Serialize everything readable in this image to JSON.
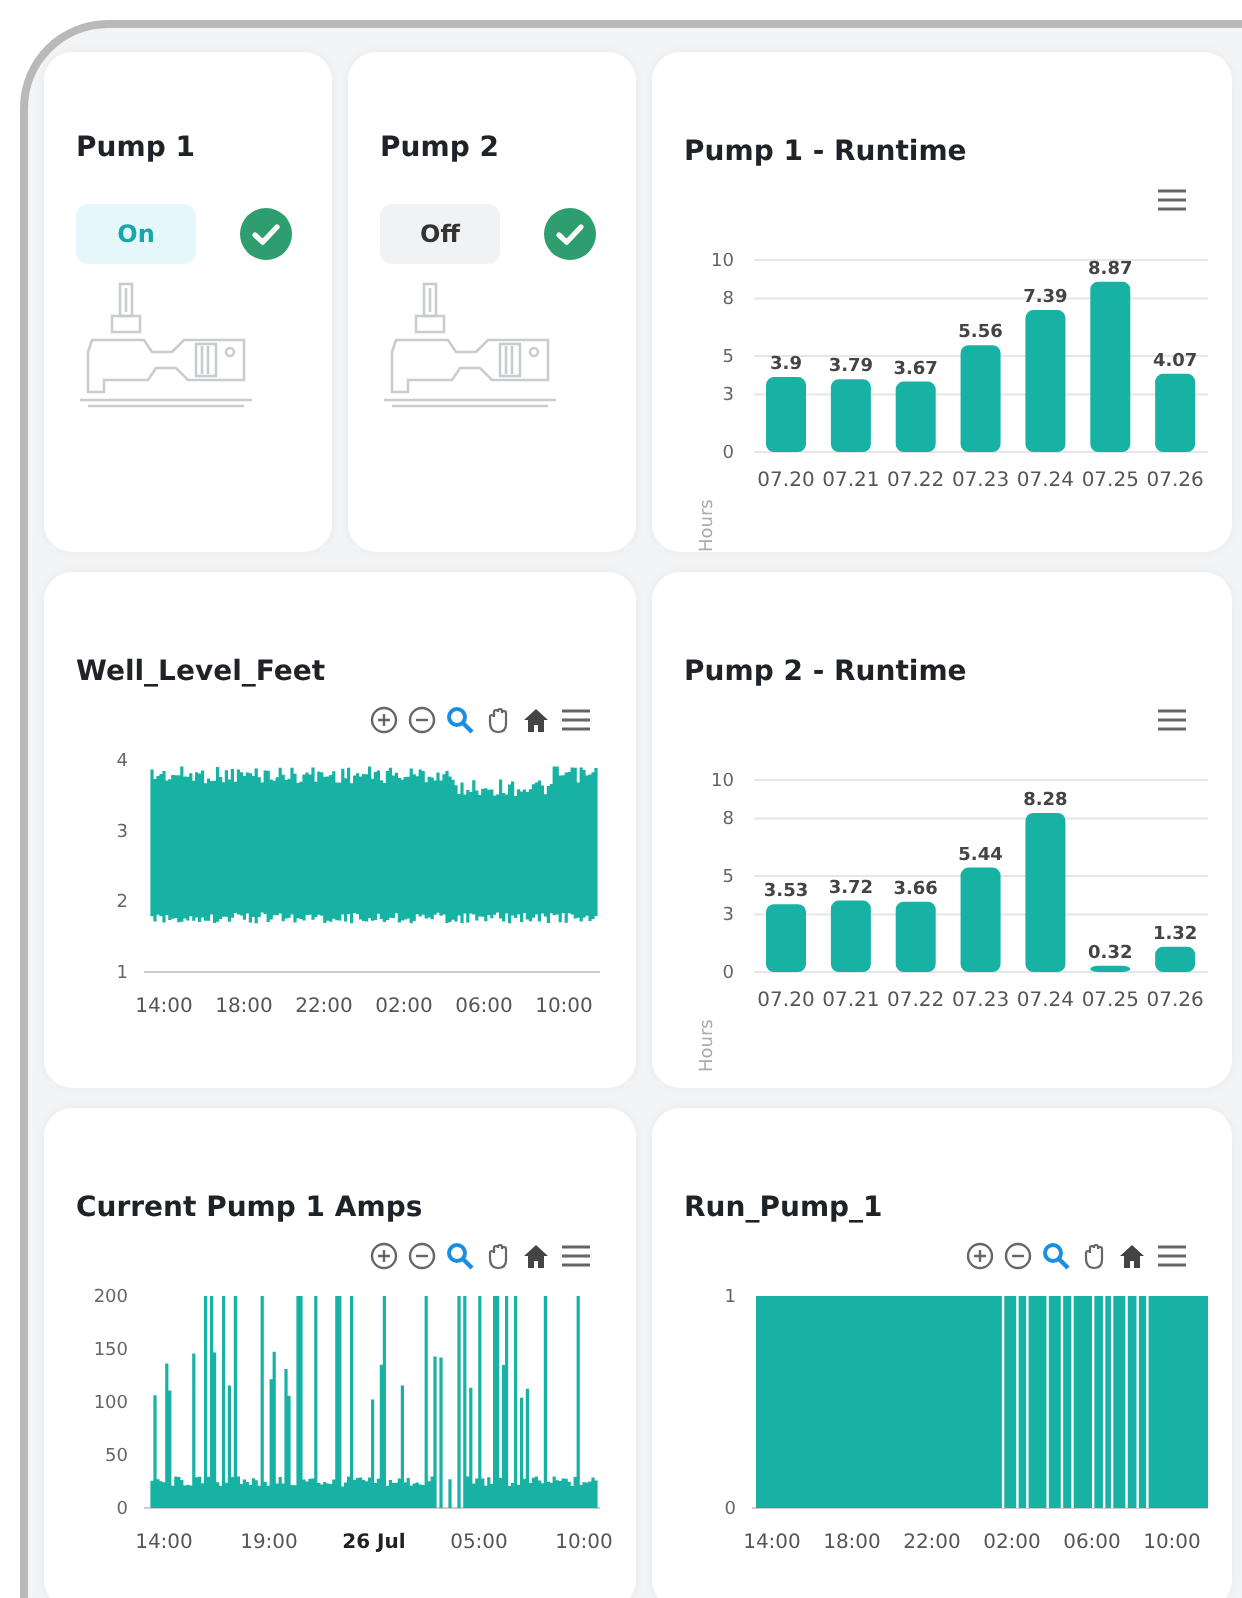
{
  "pumps": [
    {
      "title": "Pump 1",
      "status": "On",
      "on": true,
      "ok": true
    },
    {
      "title": "Pump 2",
      "status": "Off",
      "on": false,
      "ok": true
    }
  ],
  "panels": [
    {
      "kind": "bar",
      "chart_data": {
        "type": "bar",
        "title": "Pump 1 - Runtime",
        "ylabel": "Hours",
        "categories": [
          "07.20",
          "07.21",
          "07.22",
          "07.23",
          "07.24",
          "07.25",
          "07.26"
        ],
        "values": [
          3.9,
          3.79,
          3.67,
          5.56,
          7.39,
          8.87,
          4.07
        ],
        "ylim": [
          0,
          10
        ],
        "yticks": [
          0,
          3,
          5,
          8,
          10
        ],
        "grid": true,
        "data_labels": true
      }
    },
    {
      "kind": "level",
      "title": "Well_Level_Feet",
      "y_ticks": [
        "4",
        "3",
        "2",
        "1"
      ],
      "x_ticks": [
        {
          "label": "14:00",
          "bold": false
        },
        {
          "label": "18:00",
          "bold": false
        },
        {
          "label": "22:00",
          "bold": false
        },
        {
          "label": "02:00",
          "bold": false
        },
        {
          "label": "06:00",
          "bold": false
        },
        {
          "label": "10:00",
          "bold": false
        }
      ]
    },
    {
      "kind": "bar",
      "chart_data": {
        "type": "bar",
        "title": "Pump 2 - Runtime",
        "ylabel": "Hours",
        "categories": [
          "07.20",
          "07.21",
          "07.22",
          "07.23",
          "07.24",
          "07.25",
          "07.26"
        ],
        "values": [
          3.53,
          3.72,
          3.66,
          5.44,
          8.28,
          0.32,
          1.32
        ],
        "ylim": [
          0,
          10
        ],
        "yticks": [
          0,
          3,
          5,
          8,
          10
        ],
        "grid": true,
        "data_labels": true
      }
    },
    {
      "kind": "spikes",
      "title": "Current Pump 1 Amps",
      "y_ticks": [
        "200",
        "150",
        "100",
        "50",
        "0"
      ],
      "x_ticks": [
        {
          "label": "14:00",
          "bold": false
        },
        {
          "label": "19:00",
          "bold": false
        },
        {
          "label": "26 Jul",
          "bold": true
        },
        {
          "label": "05:00",
          "bold": false
        },
        {
          "label": "10:00",
          "bold": false
        }
      ]
    },
    {
      "kind": "binary",
      "title": "Run_Pump_1",
      "y_ticks": [
        "1",
        "0"
      ],
      "x_ticks": [
        {
          "label": "14:00",
          "bold": false
        },
        {
          "label": "18:00",
          "bold": false
        },
        {
          "label": "22:00",
          "bold": false
        },
        {
          "label": "02:00",
          "bold": false
        },
        {
          "label": "06:00",
          "bold": false
        },
        {
          "label": "10:00",
          "bold": false
        }
      ]
    }
  ]
}
